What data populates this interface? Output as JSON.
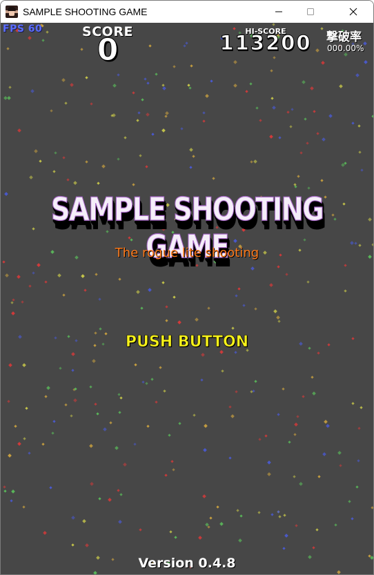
{
  "window": {
    "title": "SAMPLE SHOOTING GAME",
    "icon": "game-character-icon",
    "controls": [
      "minimize-icon",
      "maximize-icon",
      "close-icon"
    ]
  },
  "hud": {
    "fps": "FPS 60",
    "score_label": "SCORE",
    "score_value": "0",
    "hiscore_label": "HI-SCORE",
    "hiscore_value": "113200",
    "destroy_rate_label": "撃破率",
    "destroy_rate_value": "000.00%"
  },
  "title_screen": {
    "title": "SAMPLE SHOOTING GAME",
    "subtitle": "The rogue lite shooting",
    "prompt": "PUSH BUTTON",
    "version": "Version 0.4.8"
  },
  "colors": {
    "background": "#474747",
    "fps_text": "#5a6cff",
    "subtitle_text": "#ff7a1a",
    "prompt_text": "#f7f21a",
    "title_fill": "#f5eef9",
    "title_outline": "#a868c8",
    "star_colors": [
      "#c8c84a",
      "#d23a3a",
      "#4a5ad2",
      "#5ab85a",
      "#c8a040"
    ]
  }
}
